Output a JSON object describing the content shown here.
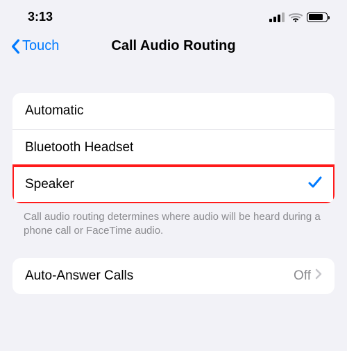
{
  "status": {
    "time": "3:13"
  },
  "nav": {
    "back": "Touch",
    "title": "Call Audio Routing"
  },
  "options": [
    {
      "label": "Automatic",
      "selected": false
    },
    {
      "label": "Bluetooth Headset",
      "selected": false
    },
    {
      "label": "Speaker",
      "selected": true
    }
  ],
  "footer": "Call audio routing determines where audio will be heard during a phone call or FaceTime audio.",
  "auto_answer": {
    "label": "Auto-Answer Calls",
    "value": "Off"
  }
}
